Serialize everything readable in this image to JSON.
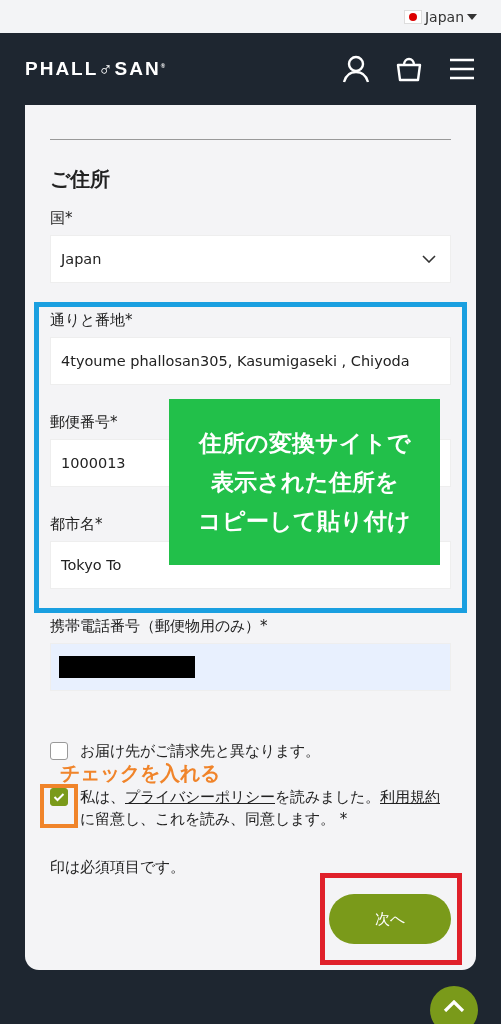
{
  "locale": {
    "label": "Japan"
  },
  "header": {
    "logo": "PHALL♂SAN$^{®}$"
  },
  "form": {
    "heading": "ご住所",
    "fields": [
      {
        "kind": "select",
        "label": "国*",
        "value": "Japan"
      },
      {
        "kind": "text",
        "label": "通りと番地*",
        "value": "4tyoume phallosan305, Kasumigaseki , Chiyoda"
      },
      {
        "kind": "text",
        "label": "郵便番号*",
        "value": "1000013"
      },
      {
        "kind": "text",
        "label": "都市名*",
        "value": "Tokyo To"
      },
      {
        "kind": "redacted",
        "label": "携帯電話番号（郵便物用のみ）*"
      }
    ],
    "checkboxes": [
      {
        "checked": false,
        "parts": [
          {
            "text": "お届け先がご請求先と異なります。"
          }
        ]
      },
      {
        "checked": true,
        "parts": [
          {
            "text": "私は、"
          },
          {
            "text": "プライバシーポリシー",
            "link": true
          },
          {
            "text": "を読みました。"
          },
          {
            "text": "利用規約",
            "link": true
          },
          {
            "text": "に留意し、これを読み、同意します。 *"
          }
        ]
      }
    ],
    "note": "印は必須項目です。",
    "button": "次へ"
  },
  "annotations": [
    {
      "kind": "frame",
      "color": "#1a9fe0"
    },
    {
      "kind": "callout",
      "color": "#22c04a",
      "lines": [
        "住所の変換サイトで",
        "表示された住所を",
        "コピーして貼り付け"
      ]
    },
    {
      "kind": "note",
      "color": "#f0842a",
      "text": "チェックを入れる"
    },
    {
      "kind": "frame",
      "color": "#f0842a"
    },
    {
      "kind": "frame",
      "color": "#e0202a"
    }
  ]
}
